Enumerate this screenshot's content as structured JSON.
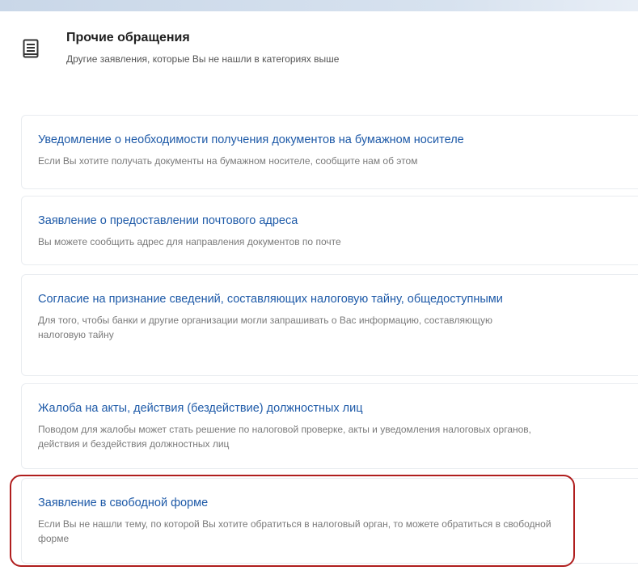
{
  "section": {
    "title": "Прочие обращения",
    "subtitle": "Другие заявления, которые Вы не нашли в категориях выше",
    "icon": "document-list-icon"
  },
  "cards": [
    {
      "title": "Уведомление о необходимости получения документов на бумажном носителе",
      "description": "Если Вы хотите получать документы на бумажном носителе, сообщите нам об этом"
    },
    {
      "title": "Заявление о предоставлении почтового адреса",
      "description": "Вы можете сообщить адрес для направления документов по почте"
    },
    {
      "title": "Согласие на признание сведений, составляющих налоговую тайну, общедоступными",
      "description": "Для того, чтобы банки и другие организации могли запрашивать о Вас информацию, составляющую налоговую тайну"
    },
    {
      "title": "Жалоба на акты, действия (бездействие) должностных лиц",
      "description": "Поводом для жалобы может стать решение по налоговой проверке, акты и уведомления налоговых органов, действия и бездействия должностных лиц"
    },
    {
      "title": "Заявление в свободной форме",
      "description": "Если Вы не нашли тему, по которой Вы хотите обратиться в налоговый орган, то можете обратиться в свободной форме"
    }
  ],
  "colors": {
    "link": "#1e5aa8",
    "highlight": "#b01e1e"
  }
}
